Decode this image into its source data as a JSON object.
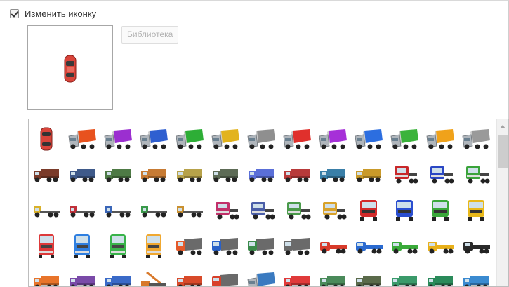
{
  "change_icon": {
    "label": "Изменить иконку",
    "checked": true
  },
  "library_button": {
    "label": "Библиотека"
  },
  "icons": [
    {
      "kind": "car",
      "color": "#d9443a"
    },
    {
      "kind": "box",
      "color": "#e8521e"
    },
    {
      "kind": "box",
      "color": "#9b2fd0"
    },
    {
      "kind": "box",
      "color": "#2f5fd0"
    },
    {
      "kind": "box",
      "color": "#2dae36"
    },
    {
      "kind": "box",
      "color": "#e2b31e"
    },
    {
      "kind": "box",
      "color": "#8f8f8f"
    },
    {
      "kind": "box",
      "color": "#e0302c"
    },
    {
      "kind": "box",
      "color": "#a630d8"
    },
    {
      "kind": "box",
      "color": "#2c6ee0"
    },
    {
      "kind": "box",
      "color": "#3bb33b"
    },
    {
      "kind": "box",
      "color": "#f0a21a"
    },
    {
      "kind": "box",
      "color": "#9a9a9a"
    },
    {
      "kind": "small",
      "color": "#7a3b2a"
    },
    {
      "kind": "small",
      "color": "#3f5a8a"
    },
    {
      "kind": "small",
      "color": "#4e7a45"
    },
    {
      "kind": "small",
      "color": "#c77b34"
    },
    {
      "kind": "small",
      "color": "#b7a24a"
    },
    {
      "kind": "small",
      "color": "#5d6b56"
    },
    {
      "kind": "small",
      "color": "#5a6fd8"
    },
    {
      "kind": "small",
      "color": "#b83a3a"
    },
    {
      "kind": "small",
      "color": "#3a7fa8"
    },
    {
      "kind": "small",
      "color": "#c99a2a"
    },
    {
      "kind": "tractor",
      "color": "#c8282a"
    },
    {
      "kind": "tractor",
      "color": "#2a47c4"
    },
    {
      "kind": "tractor",
      "color": "#3aa33a"
    },
    {
      "kind": "flat",
      "color": "#d9b12a"
    },
    {
      "kind": "flat",
      "color": "#c0303a"
    },
    {
      "kind": "flat",
      "color": "#3a66b8"
    },
    {
      "kind": "flat",
      "color": "#3a9a4a"
    },
    {
      "kind": "flat",
      "color": "#c99030"
    },
    {
      "kind": "tractor",
      "color": "#c2306a"
    },
    {
      "kind": "tractor",
      "color": "#4a5ea8"
    },
    {
      "kind": "tractor",
      "color": "#4a9a4a"
    },
    {
      "kind": "tractor",
      "color": "#d8a22a"
    },
    {
      "kind": "front",
      "color": "#d22a2a"
    },
    {
      "kind": "front",
      "color": "#2a4ed0"
    },
    {
      "kind": "front",
      "color": "#3aa83a"
    },
    {
      "kind": "front",
      "color": "#e8b81a"
    },
    {
      "kind": "cab",
      "color": "#dd3a3a"
    },
    {
      "kind": "cab",
      "color": "#2f7fe0"
    },
    {
      "kind": "cab",
      "color": "#39b34a"
    },
    {
      "kind": "cab",
      "color": "#f0a830"
    },
    {
      "kind": "dump",
      "color": "#e45a2a"
    },
    {
      "kind": "dump",
      "color": "#2a62c8"
    },
    {
      "kind": "dump",
      "color": "#3a8a4a"
    },
    {
      "kind": "dump",
      "color": "#6a6a6a"
    },
    {
      "kind": "long",
      "color": "#d83a2a"
    },
    {
      "kind": "long",
      "color": "#2a6ad0"
    },
    {
      "kind": "long",
      "color": "#3aaa3a"
    },
    {
      "kind": "long",
      "color": "#e8b01a"
    },
    {
      "kind": "long",
      "color": "#2a2a2a"
    },
    {
      "kind": "small",
      "color": "#e8742a"
    },
    {
      "kind": "small",
      "color": "#7a4aa8"
    },
    {
      "kind": "small",
      "color": "#3a6ac8"
    },
    {
      "kind": "crane",
      "color": "#d8782a"
    },
    {
      "kind": "small",
      "color": "#d84a2a"
    },
    {
      "kind": "dump",
      "color": "#d8402a"
    },
    {
      "kind": "box",
      "color": "#3a7ac0"
    },
    {
      "kind": "small",
      "color": "#e03a3a"
    },
    {
      "kind": "small",
      "color": "#4a8a5a"
    },
    {
      "kind": "small",
      "color": "#5a6a4a"
    },
    {
      "kind": "small",
      "color": "#3a9a6a"
    },
    {
      "kind": "small",
      "color": "#2a8a5a"
    },
    {
      "kind": "small",
      "color": "#3a8ad0"
    }
  ]
}
